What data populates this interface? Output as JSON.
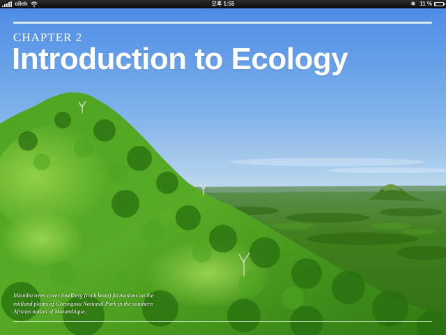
{
  "status_bar": {
    "carrier": "olleh",
    "time": "오후 1:55",
    "battery_percent": "11 %",
    "battery_level": 0.11,
    "icons": [
      "signal-icon",
      "wifi-icon",
      "bluetooth-icon",
      "battery-icon"
    ]
  },
  "chapter": {
    "label": "CHAPTER 2",
    "title": "Introduction to Ecology"
  },
  "photo": {
    "caption": "Miombo trees cover inselberg (rock knob) formations on the midland plains of Gorongosa National Park in the southern African nation of Mozambique."
  },
  "colors": {
    "sky_top": "#4f8fe6",
    "sky_horizon": "#b9d6ee",
    "forest_light": "#6fc234",
    "forest_dark": "#2c6f12"
  }
}
